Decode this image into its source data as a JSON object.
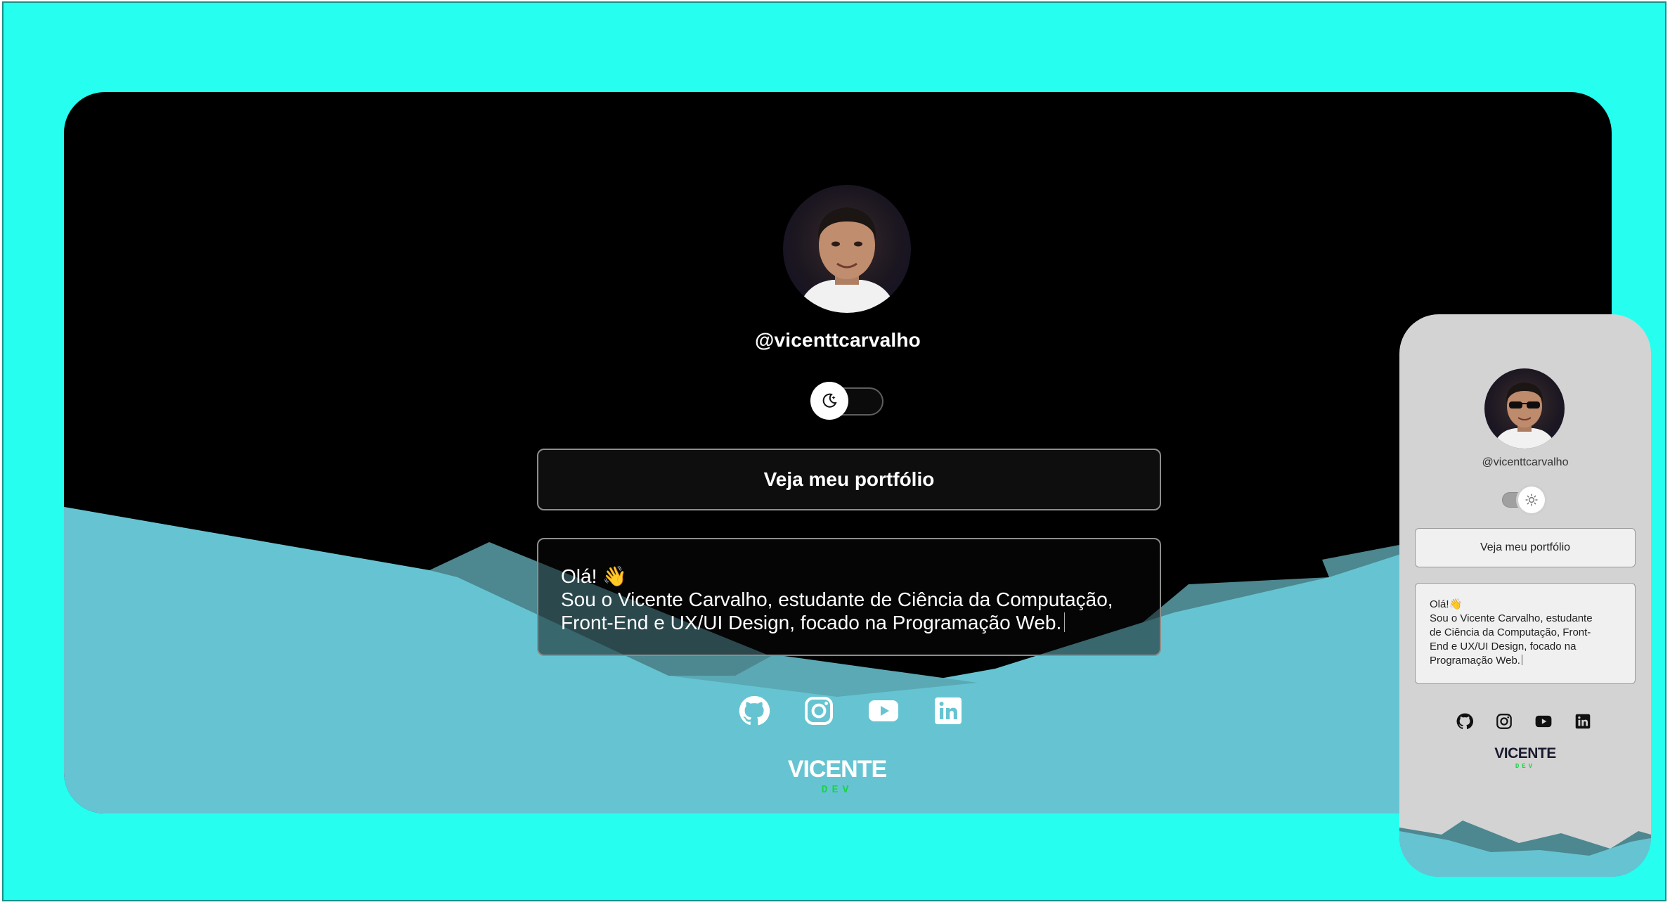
{
  "desktop": {
    "handle": "@vicenttcarvalho",
    "theme_toggle": {
      "state": "dark",
      "icon": "moon-icon"
    },
    "portfolio_button": "Veja meu portfólio",
    "bio": {
      "line1": "Olá! 👋",
      "line2": "Sou o Vicente Carvalho, estudante de Ciência da Computação,",
      "line3": "Front-End e UX/UI Design, focado na Programação Web."
    },
    "social_links": [
      "github-icon",
      "instagram-icon",
      "youtube-icon",
      "linkedin-icon"
    ],
    "logo": {
      "word": "VICENTE",
      "sub": "DEV"
    }
  },
  "mobile": {
    "handle": "@vicenttcarvalho",
    "theme_toggle": {
      "state": "light",
      "icon": "sun-icon"
    },
    "portfolio_button": "Veja meu portfólio",
    "bio": {
      "line1": "Olá!👋",
      "line2": "Sou o Vicente Carvalho, estudante",
      "line3": "de Ciência da Computação, Front-",
      "line4": "End e UX/UI Design, focado na",
      "line5": "Programação Web."
    },
    "social_links": [
      "github-icon",
      "instagram-icon",
      "youtube-icon",
      "linkedin-icon"
    ],
    "logo": {
      "word": "VICENTE",
      "sub": "DEV"
    }
  },
  "colors": {
    "background": "#26fff0",
    "desktop_card": "#000000",
    "mobile_card": "#d3d3d3",
    "wave_light": "#66c4d2",
    "wave_mid": "#4d8790",
    "logo_sub": "#1bd34a"
  }
}
